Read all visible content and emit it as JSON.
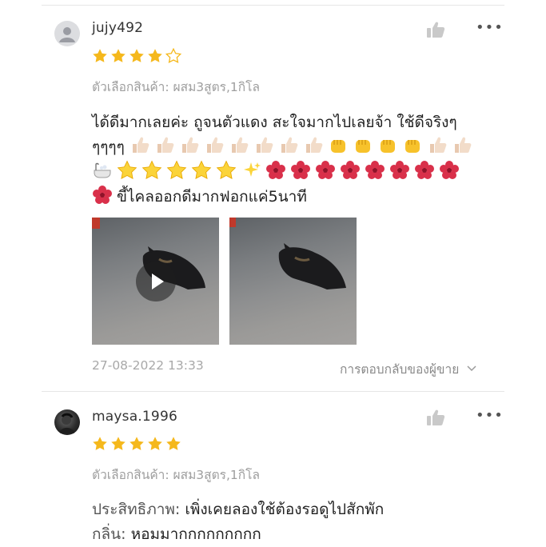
{
  "reviews": [
    {
      "username": "jujy492",
      "rating": 4,
      "max_rating": 5,
      "variant": "ตัวเลือกสินค้า: ผสม3สูตร,1กิโล",
      "text_line1": "ได้ดีมากเลยค่ะ ถูจนตัวแดง สะใจมากไปเลยจ้า ใช้ดีจริงๆ",
      "text_line2_prefix": "ๆๆๆๆ",
      "text_line4_suffix": "ขี้ไคลออกดีมากฟอกแค่5นาที",
      "media": [
        {
          "type": "video",
          "icon": "play-icon"
        },
        {
          "type": "image"
        }
      ],
      "timestamp": "27-08-2022 13:33",
      "seller_reply": "การตอบกลับของผู้ขาย"
    },
    {
      "username": "maysa.1996",
      "rating": 5,
      "max_rating": 5,
      "variant": "ตัวเลือกสินค้า: ผสม3สูตร,1กิโล",
      "effectiveness_label": "ประสิทธิภาพ:",
      "effectiveness_value": "เพิ่งเคยลองใช้ต้องรอดูไปสักพัก",
      "scent_label": "กลิ่น:",
      "scent_value": "หอมมากกกกกกกกก"
    }
  ],
  "colors": {
    "star": "#f5b81c",
    "star_empty_outline": "#f5b81c",
    "muted_text": "#9e9e9e",
    "divider": "#e6e6e6"
  },
  "icons": [
    "thumbs-up-icon",
    "more-icon",
    "play-icon",
    "chevron-down-icon",
    "user-icon"
  ]
}
